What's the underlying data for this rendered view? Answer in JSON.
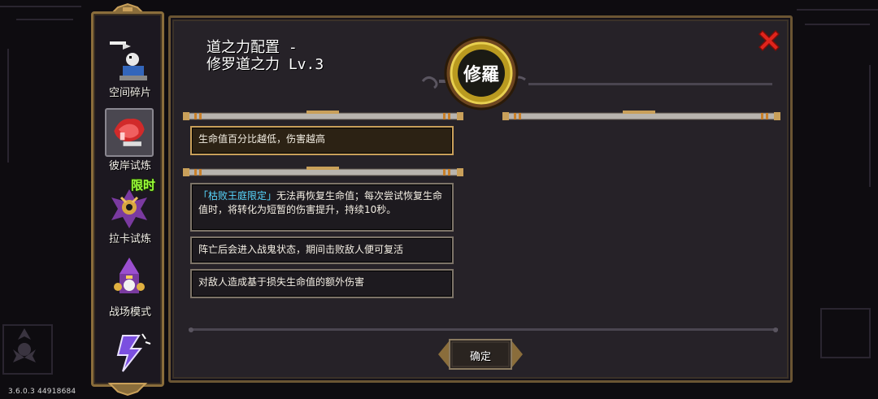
{
  "version_text": "3.6.0.3 44918684",
  "sidebar": {
    "items": [
      {
        "label": "空间碎片",
        "icon": "space-fragment-icon"
      },
      {
        "label": "彼岸试炼",
        "icon": "shore-trial-icon"
      },
      {
        "label": "拉卡试炼",
        "icon": "raka-trial-icon",
        "badge": "限时"
      },
      {
        "label": "战场模式",
        "icon": "battlefield-mode-icon"
      },
      {
        "label": "",
        "icon": "lightning-icon"
      }
    ]
  },
  "panel": {
    "title_line1": "道之力配置 -",
    "title_line2": "修罗道之力 Lv.3",
    "emblem_text": "修羅",
    "rows": [
      {
        "segments": [
          {
            "text": "生命值百分比越低，伤害越高",
            "color": "normal"
          }
        ]
      },
      {
        "segments": [
          {
            "text": "「枯败王庭限定」",
            "color": "cyan"
          },
          {
            "text": "无法再恢复生命值；每次尝试恢复生命值时，将转化为短暂的伤害提升，持续10秒。",
            "color": "normal"
          }
        ]
      },
      {
        "segments": [
          {
            "text": "阵亡后会进入战鬼状态，期间击败敌人便可复活",
            "color": "normal"
          }
        ]
      },
      {
        "segments": [
          {
            "text": "对敌人造成基于损失生命值的额外伤害",
            "color": "normal"
          }
        ]
      }
    ],
    "confirm_label": "确定"
  },
  "colors": {
    "panel_bg": "#262228",
    "border_gold": "#c9a05a",
    "cyan_text": "#58d8ff",
    "limited_green": "#9cff3a",
    "close_red": "#e0241c"
  }
}
